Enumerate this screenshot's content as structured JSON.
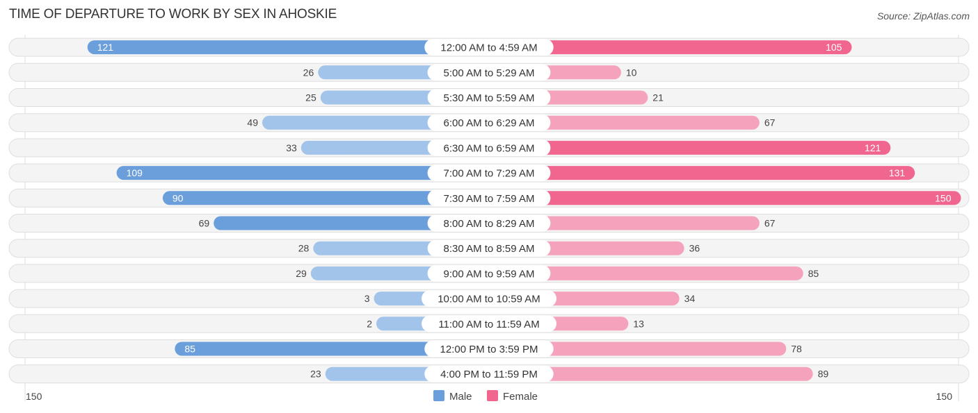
{
  "title": "TIME OF DEPARTURE TO WORK BY SEX IN AHOSKIE",
  "source": "Source: ZipAtlas.com",
  "colors": {
    "male": "#6a9fdc",
    "male_light": "#a3c4ea",
    "female": "#f0668f",
    "female_light": "#f5a3bc"
  },
  "chart_data": {
    "type": "bar",
    "orientation": "horizontal-diverging",
    "title": "TIME OF DEPARTURE TO WORK BY SEX IN AHOSKIE",
    "categories": [
      "12:00 AM to 4:59 AM",
      "5:00 AM to 5:29 AM",
      "5:30 AM to 5:59 AM",
      "6:00 AM to 6:29 AM",
      "6:30 AM to 6:59 AM",
      "7:00 AM to 7:29 AM",
      "7:30 AM to 7:59 AM",
      "8:00 AM to 8:29 AM",
      "8:30 AM to 8:59 AM",
      "9:00 AM to 9:59 AM",
      "10:00 AM to 10:59 AM",
      "11:00 AM to 11:59 AM",
      "12:00 PM to 3:59 PM",
      "4:00 PM to 11:59 PM"
    ],
    "series": [
      {
        "name": "Male",
        "values": [
          121,
          26,
          25,
          49,
          33,
          109,
          90,
          69,
          28,
          29,
          3,
          2,
          85,
          23
        ]
      },
      {
        "name": "Female",
        "values": [
          105,
          10,
          21,
          67,
          121,
          131,
          150,
          67,
          36,
          85,
          34,
          13,
          78,
          89
        ]
      }
    ],
    "axis": {
      "left_tick": "150",
      "right_tick": "150",
      "max": 150
    },
    "legend": {
      "position": "bottom-center",
      "items": [
        "Male",
        "Female"
      ]
    }
  }
}
